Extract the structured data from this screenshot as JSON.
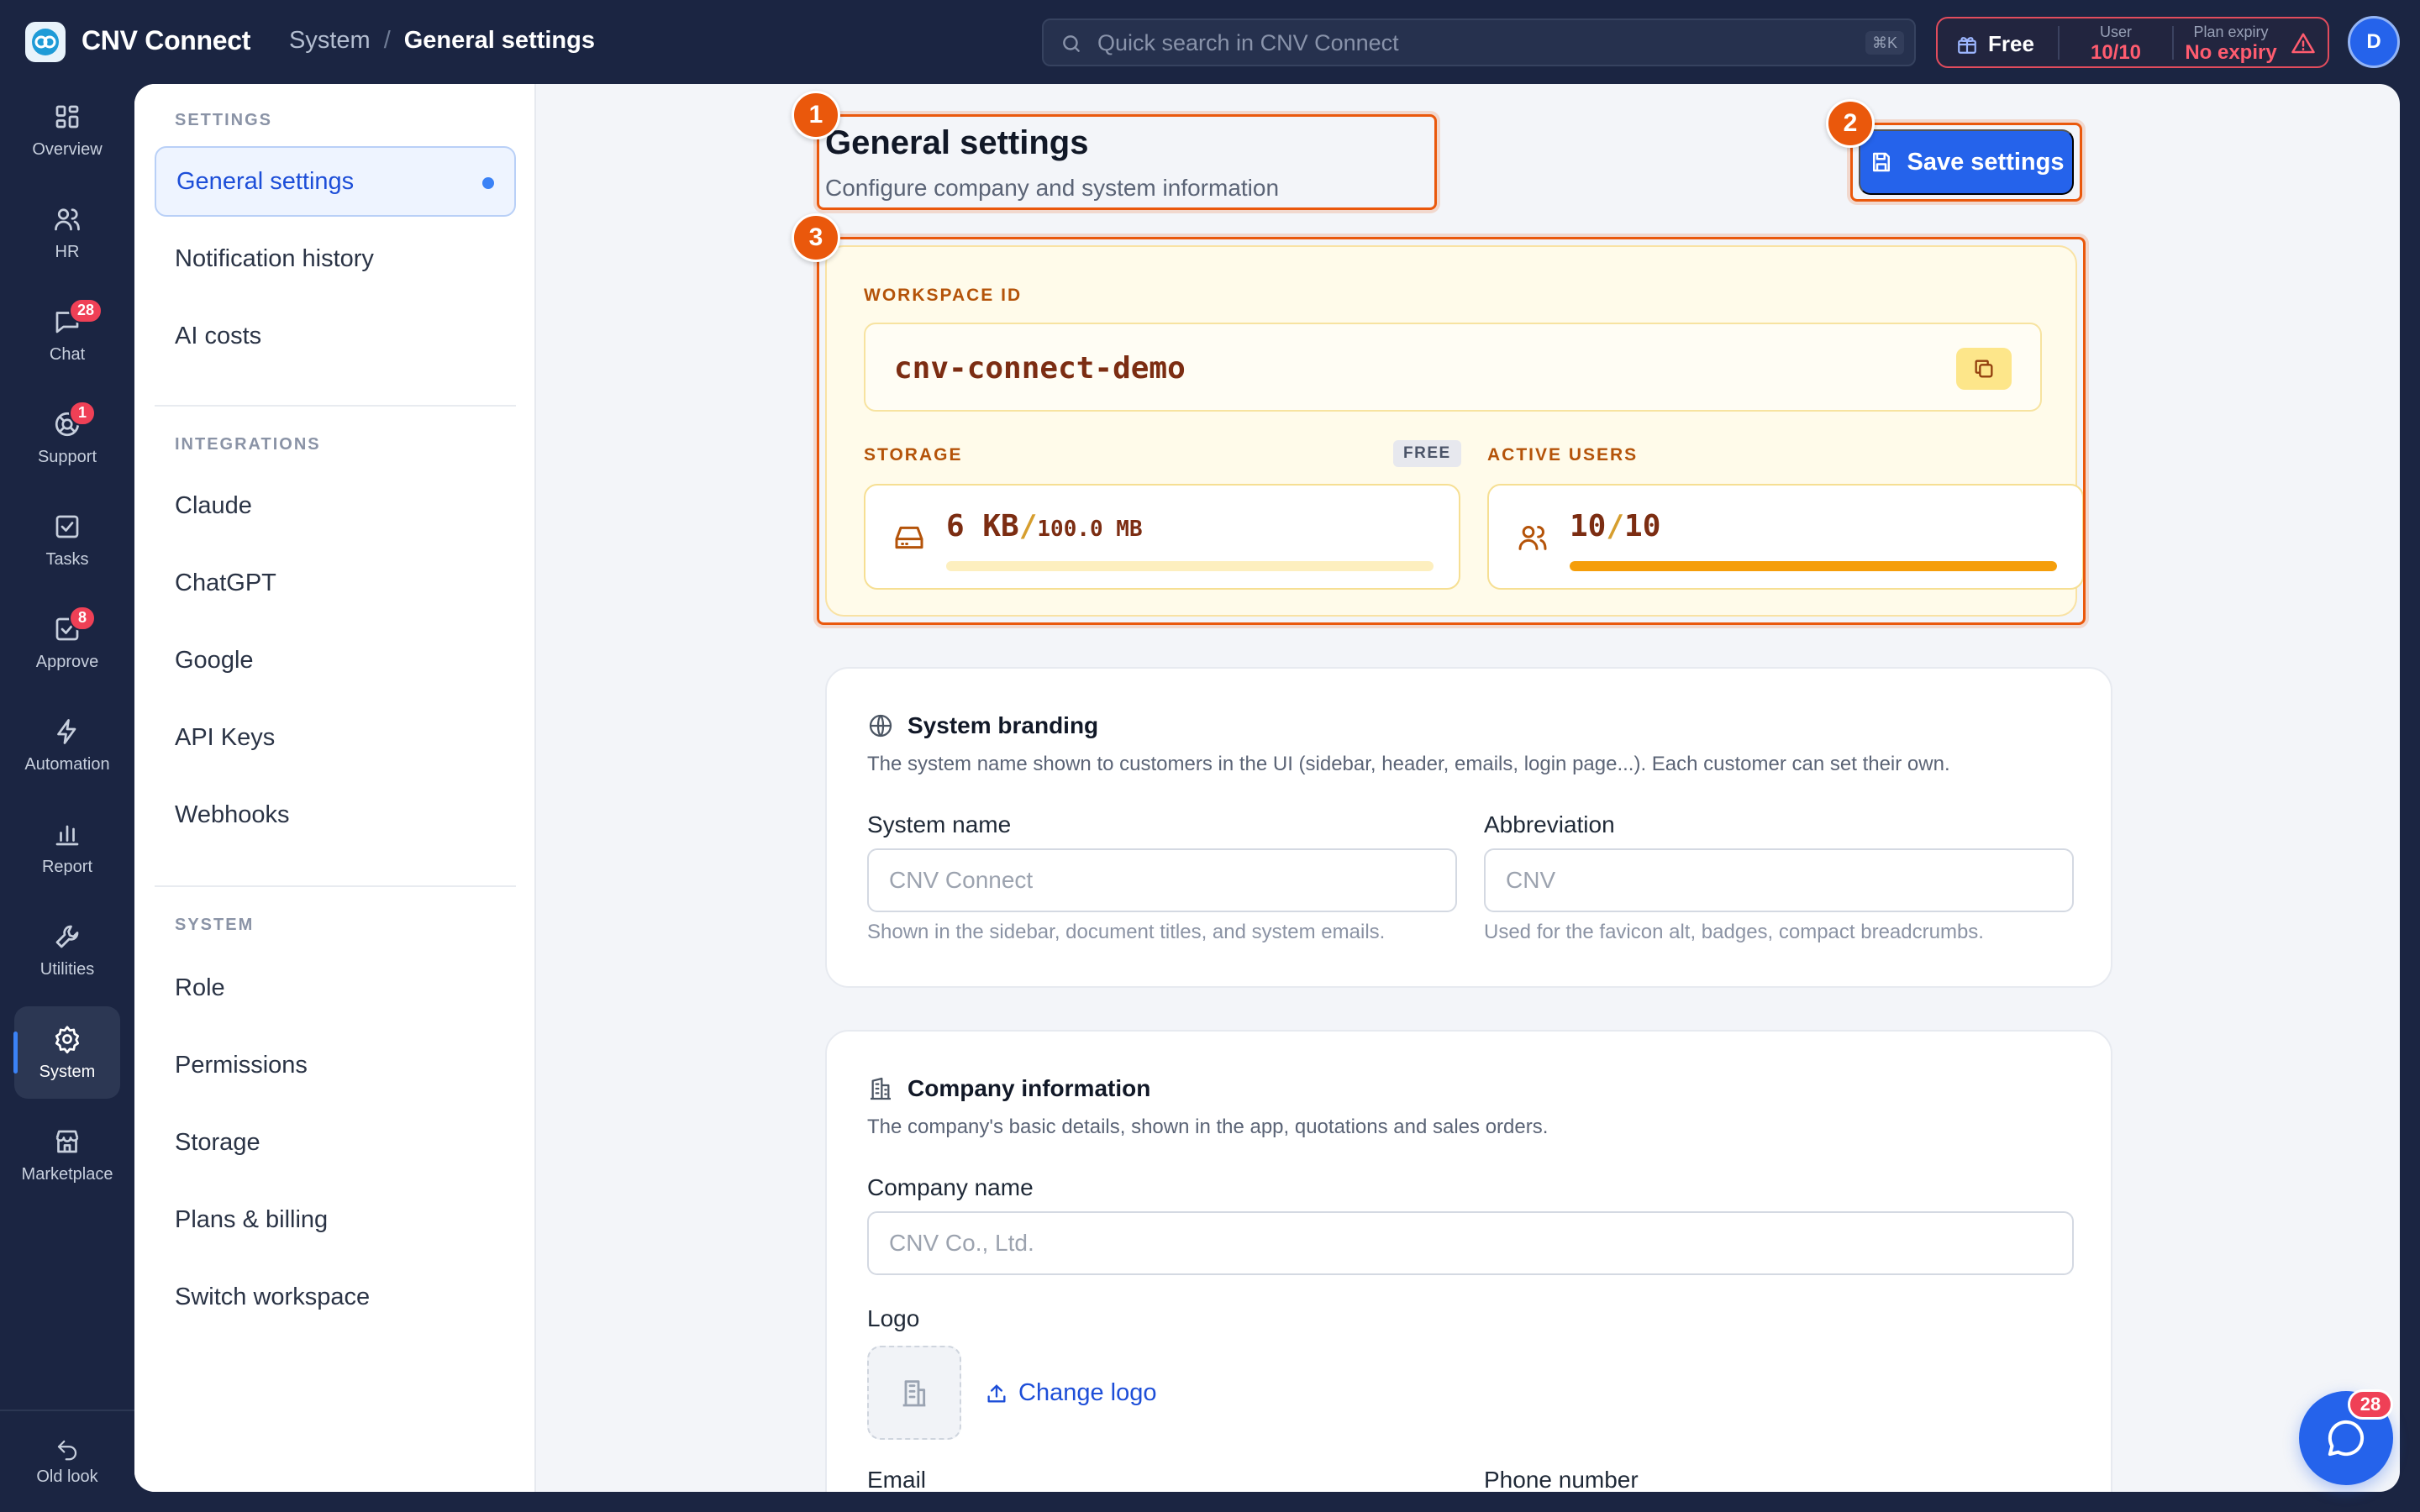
{
  "app": {
    "name": "CNV Connect"
  },
  "breadcrumb": {
    "parent": "System",
    "separator": "/",
    "current": "General settings"
  },
  "search": {
    "placeholder": "Quick search in CNV Connect",
    "shortcut": "⌘K"
  },
  "plan": {
    "name": "Free",
    "user_caption": "User",
    "user_value": "10/10",
    "expiry_caption": "Plan expiry",
    "expiry_value": "No expiry"
  },
  "user": {
    "avatar_initial": "D"
  },
  "rail": {
    "items": [
      {
        "label": "Overview",
        "icon": "grid-icon"
      },
      {
        "label": "HR",
        "icon": "users-icon"
      },
      {
        "label": "Chat",
        "icon": "chat-icon",
        "badge": "28"
      },
      {
        "label": "Support",
        "icon": "lifebuoy-icon",
        "badge": "1"
      },
      {
        "label": "Tasks",
        "icon": "checkbox-icon"
      },
      {
        "label": "Approve",
        "icon": "approve-icon",
        "badge": "8"
      },
      {
        "label": "Automation",
        "icon": "lightning-icon"
      },
      {
        "label": "Report",
        "icon": "bar-chart-icon"
      },
      {
        "label": "Utilities",
        "icon": "wrench-icon"
      },
      {
        "label": "System",
        "icon": "gear-icon",
        "active": true
      },
      {
        "label": "Marketplace",
        "icon": "store-icon"
      }
    ],
    "bottom_label": "Old look"
  },
  "subnav": {
    "settings_caption": "SETTINGS",
    "settings_items": [
      "General settings",
      "Notification history",
      "AI costs"
    ],
    "integrations_caption": "INTEGRATIONS",
    "integrations_items": [
      "Claude",
      "ChatGPT",
      "Google",
      "API Keys",
      "Webhooks"
    ],
    "system_caption": "SYSTEM",
    "system_items": [
      "Role",
      "Permissions",
      "Storage",
      "Plans & billing",
      "Switch workspace"
    ]
  },
  "page": {
    "title": "General settings",
    "subtitle": "Configure company and system information",
    "save_label": "Save settings"
  },
  "annotations": [
    "1",
    "2",
    "3"
  ],
  "workspace": {
    "id_caption": "WORKSPACE ID",
    "id_value": "cnv-connect-demo",
    "storage_caption": "STORAGE",
    "storage_tag": "FREE",
    "storage_used": "6 KB",
    "storage_sep": "/",
    "storage_total": "100.0 MB",
    "storage_fraction": 0.0,
    "users_caption": "ACTIVE USERS",
    "users_used": "10",
    "users_sep": "/",
    "users_total": "10",
    "users_fraction": 1.0
  },
  "branding": {
    "title": "System branding",
    "description": "The system name shown to customers in the UI (sidebar, header, emails, login page...). Each customer can set their own.",
    "system_name_label": "System name",
    "system_name_placeholder": "CNV Connect",
    "system_name_help": "Shown in the sidebar, document titles, and system emails.",
    "abbr_label": "Abbreviation",
    "abbr_placeholder": "CNV",
    "abbr_help": "Used for the favicon alt, badges, compact breadcrumbs."
  },
  "company": {
    "title": "Company information",
    "description": "The company's basic details, shown in the app, quotations and sales orders.",
    "name_label": "Company name",
    "name_placeholder": "CNV Co., Ltd.",
    "logo_label": "Logo",
    "change_logo_label": "Change logo",
    "email_label": "Email",
    "phone_label": "Phone number"
  },
  "chat_fab": {
    "badge": "28"
  },
  "colors": {
    "background": "#1b2542",
    "accent": "#2563eb",
    "annotation": "#ea580c",
    "danger": "#ef4056",
    "workspace_bg": "#fffbea"
  }
}
